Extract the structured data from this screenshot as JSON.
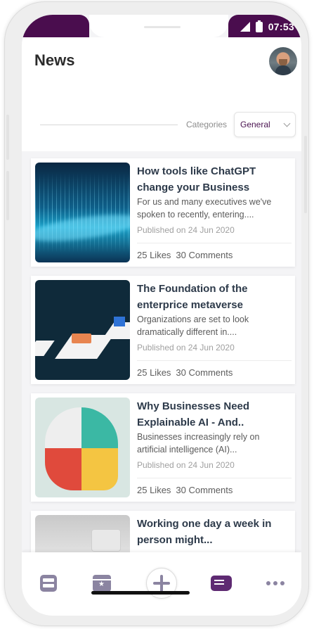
{
  "status_bar": {
    "time": "07:53"
  },
  "header": {
    "title": "News"
  },
  "filter": {
    "categories_label": "Categories",
    "selected_category": "General"
  },
  "news": [
    {
      "title": "How tools like ChatGPT change your Business",
      "excerpt": "For us and many executives we've spoken to recently, entering....",
      "date": "Published on 24 Jun 2020",
      "likes": "25 Likes",
      "comments": "30 Comments"
    },
    {
      "title": "The Foundation of the enterprice metaverse",
      "excerpt": "Organizations are set to look dramatically different in....",
      "date": "Published on 24 Jun 2020",
      "likes": "25 Likes",
      "comments": "30 Comments"
    },
    {
      "title": "Why Businesses Need Explainable AI - And..",
      "excerpt": "Businesses increasingly rely on artificial intelligence (AI)...",
      "date": "Published on 24 Jun 2020",
      "likes": "25 Likes",
      "comments": "30 Comments"
    },
    {
      "title": "Working one day a week in person might..."
    }
  ],
  "tabs": [
    {
      "icon": "home-icon",
      "active": false
    },
    {
      "icon": "calendar-icon",
      "active": false
    },
    {
      "icon": "plus-icon",
      "active": false
    },
    {
      "icon": "news-icon",
      "active": true
    },
    {
      "icon": "more-icon",
      "active": false
    }
  ],
  "colors": {
    "brand": "#4a0d4e",
    "active_tab": "#5e2a72",
    "inactive_tab": "#8b84a1"
  }
}
